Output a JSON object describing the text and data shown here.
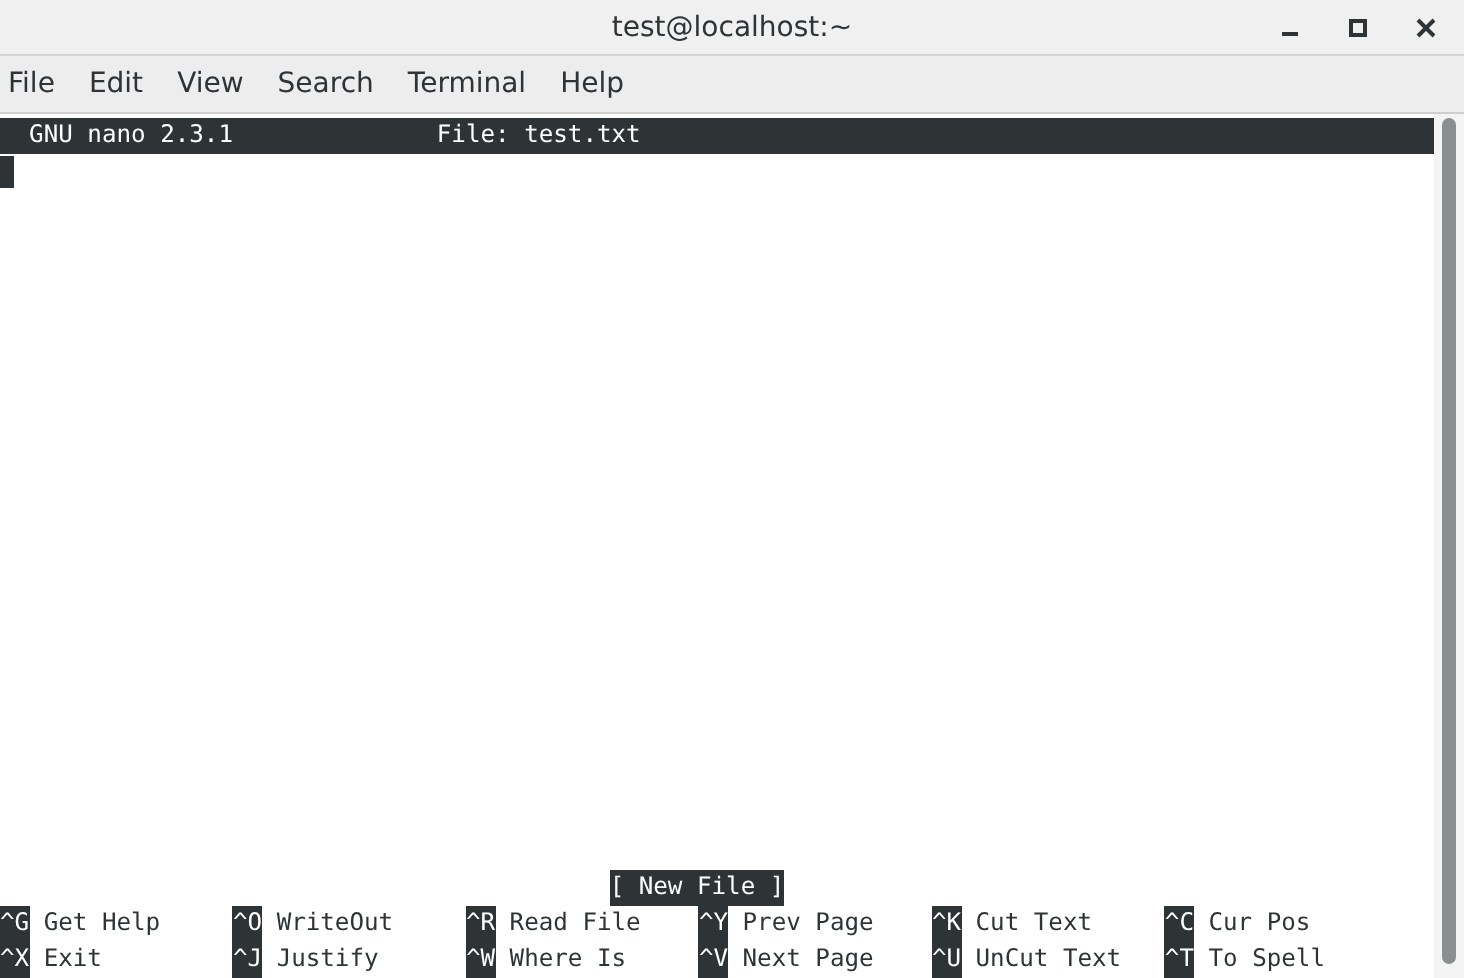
{
  "window": {
    "title": "test@localhost:~"
  },
  "menu": [
    "File",
    "Edit",
    "View",
    "Search",
    "Terminal",
    "Help"
  ],
  "nano": {
    "version": "GNU nano 2.3.1",
    "file": "File: test.txt",
    "status": "[ New File ]",
    "shortcuts": [
      [
        {
          "key": "^G",
          "label": "Get Help"
        },
        {
          "key": "^O",
          "label": "WriteOut"
        },
        {
          "key": "^R",
          "label": "Read File"
        },
        {
          "key": "^Y",
          "label": "Prev Page"
        },
        {
          "key": "^K",
          "label": "Cut Text"
        },
        {
          "key": "^C",
          "label": "Cur Pos"
        }
      ],
      [
        {
          "key": "^X",
          "label": "Exit"
        },
        {
          "key": "^J",
          "label": "Justify"
        },
        {
          "key": "^W",
          "label": "Where Is"
        },
        {
          "key": "^V",
          "label": "Next Page"
        },
        {
          "key": "^U",
          "label": "UnCut Text"
        },
        {
          "key": "^T",
          "label": "To Spell"
        }
      ]
    ]
  }
}
